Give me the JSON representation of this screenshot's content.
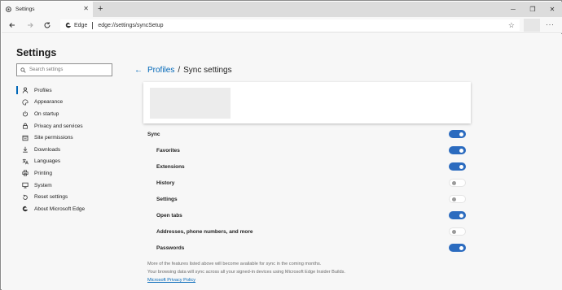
{
  "tab": {
    "title": "Settings",
    "close": "✕",
    "new_tab": "+"
  },
  "window": {
    "minimize": "─",
    "maximize": "❐",
    "close": "✕"
  },
  "address_bar": {
    "edge_label": "Edge",
    "url": "edge://settings/syncSetup",
    "favorite": "☆",
    "more": "···"
  },
  "sidebar": {
    "title": "Settings",
    "search_placeholder": "Search settings",
    "items": [
      {
        "label": "Profiles",
        "icon": "person-icon",
        "active": true
      },
      {
        "label": "Appearance",
        "icon": "palette-icon",
        "active": false
      },
      {
        "label": "On startup",
        "icon": "power-icon",
        "active": false
      },
      {
        "label": "Privacy and services",
        "icon": "lock-icon",
        "active": false
      },
      {
        "label": "Site permissions",
        "icon": "site-permissions-icon",
        "active": false
      },
      {
        "label": "Downloads",
        "icon": "download-icon",
        "active": false
      },
      {
        "label": "Languages",
        "icon": "languages-icon",
        "active": false
      },
      {
        "label": "Printing",
        "icon": "printer-icon",
        "active": false
      },
      {
        "label": "System",
        "icon": "system-icon",
        "active": false
      },
      {
        "label": "Reset settings",
        "icon": "reset-icon",
        "active": false
      },
      {
        "label": "About Microsoft Edge",
        "icon": "edge-logo-icon",
        "active": false
      }
    ]
  },
  "main": {
    "breadcrumb": {
      "back": "←",
      "parent": "Profiles",
      "separator": "/",
      "current": "Sync settings"
    },
    "sync_rows": [
      {
        "label": "Sync",
        "on": true,
        "level": "top"
      },
      {
        "label": "Favorites",
        "on": true,
        "level": "sub"
      },
      {
        "label": "Extensions",
        "on": true,
        "level": "sub"
      },
      {
        "label": "History",
        "on": false,
        "level": "sub"
      },
      {
        "label": "Settings",
        "on": false,
        "level": "sub"
      },
      {
        "label": "Open tabs",
        "on": true,
        "level": "sub"
      },
      {
        "label": "Addresses, phone numbers, and more",
        "on": false,
        "level": "sub"
      },
      {
        "label": "Passwords",
        "on": true,
        "level": "sub"
      }
    ],
    "note1": "More of the features listed above will become available for sync in the coming months.",
    "note2": "Your browsing data will sync across all your signed-in devices using Microsoft Edge Insider Builds.",
    "privacy_link": "Microsoft Privacy Policy"
  },
  "colors": {
    "accent": "#0067b8",
    "toggle_on": "#2b6bbf",
    "background": "#f7f7f7"
  }
}
